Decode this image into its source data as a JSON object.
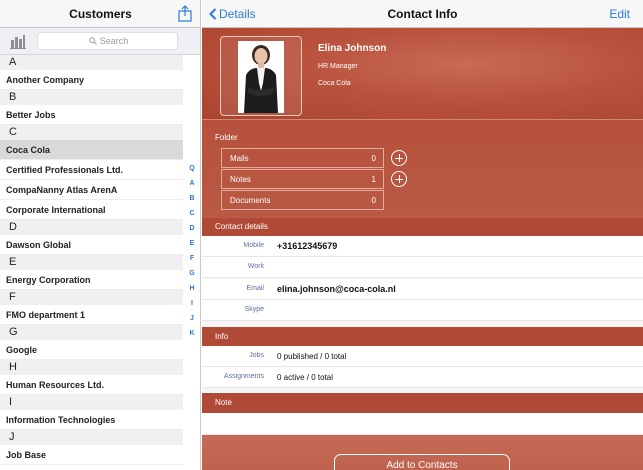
{
  "left": {
    "title": "Customers",
    "search_placeholder": "Search",
    "sections": [
      {
        "letter": "A",
        "items": [
          "Another Company"
        ]
      },
      {
        "letter": "B",
        "items": [
          "Better Jobs"
        ]
      },
      {
        "letter": "C",
        "items": [
          "Coca Cola",
          "Certified Professionals Ltd.",
          "CompaNanny Atlas ArenA",
          "Corporate International"
        ]
      },
      {
        "letter": "D",
        "items": [
          "Dawson Global"
        ]
      },
      {
        "letter": "E",
        "items": [
          "Energy Corporation"
        ]
      },
      {
        "letter": "F",
        "items": [
          "FMO department 1"
        ]
      },
      {
        "letter": "G",
        "items": [
          "Google"
        ]
      },
      {
        "letter": "H",
        "items": [
          "Human Resources Ltd."
        ]
      },
      {
        "letter": "I",
        "items": [
          "Information Technologies"
        ]
      },
      {
        "letter": "J",
        "items": [
          "Job Base"
        ]
      }
    ],
    "selected": "Coca Cola",
    "index": [
      "Q",
      "A",
      "B",
      "C",
      "D",
      "E",
      "F",
      "G",
      "H",
      "I",
      "J",
      "K"
    ]
  },
  "right": {
    "back_label": "Details",
    "title": "Contact Info",
    "edit_label": "Edit",
    "profile": {
      "name": "Elina Johnson",
      "role": "HR Manager",
      "company": "Coca Cola"
    },
    "folder": {
      "heading": "Folder",
      "rows": [
        {
          "label": "Mails",
          "value": "0"
        },
        {
          "label": "Notes",
          "value": "1"
        },
        {
          "label": "Documents",
          "value": "0"
        }
      ]
    },
    "contact_details": {
      "heading": "Contact details",
      "rows": [
        {
          "key": "Mobile",
          "value": "+31612345679"
        },
        {
          "key": "Work",
          "value": ""
        },
        {
          "key": "Email",
          "value": "elina.johnson@coca-cola.nl"
        },
        {
          "key": "Skype",
          "value": ""
        }
      ]
    },
    "info": {
      "heading": "Info",
      "rows": [
        {
          "key": "Jobs",
          "value": "0 published / 0 total"
        },
        {
          "key": "Assignments",
          "value": "0 active / 0 total"
        }
      ]
    },
    "note": {
      "heading": "Note",
      "value": ""
    },
    "add_button": "Add to Contacts"
  },
  "colors": {
    "accent": "#2a7ad8",
    "brand_red": "#b04a36"
  },
  "icons": [
    "share-icon",
    "grid-icon",
    "search-icon",
    "chevron-left-icon",
    "plus-circle-icon",
    "avatar-photo"
  ]
}
